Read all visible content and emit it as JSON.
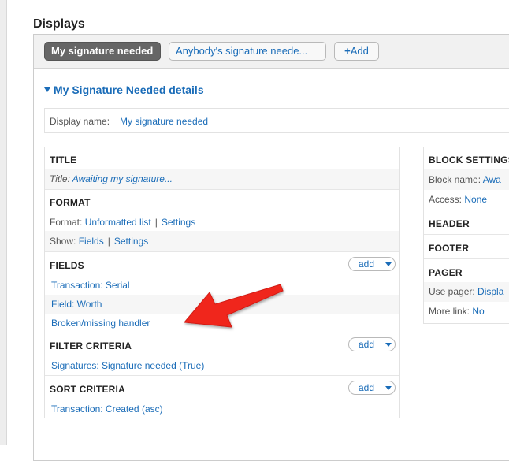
{
  "page": {
    "heading": "Displays"
  },
  "tabs": {
    "active": "My signature needed",
    "inactive": "Anybody's signature neede...",
    "add": "Add"
  },
  "details": {
    "title": "My Signature Needed details",
    "display_name_label": "Display name:",
    "display_name_value": "My signature needed"
  },
  "left": {
    "title": {
      "header": "TITLE",
      "label": "Title:",
      "value": "Awaiting my signature..."
    },
    "format": {
      "header": "FORMAT",
      "format_label": "Format:",
      "format_value": "Unformatted list",
      "format_settings": "Settings",
      "show_label": "Show:",
      "show_value": "Fields",
      "show_settings": "Settings"
    },
    "fields": {
      "header": "FIELDS",
      "add": "add",
      "items": [
        "Transaction: Serial",
        "Field: Worth",
        "Broken/missing handler"
      ]
    },
    "filter": {
      "header": "FILTER CRITERIA",
      "add": "add",
      "items": [
        "Signatures: Signature needed (True)"
      ]
    },
    "sort": {
      "header": "SORT CRITERIA",
      "add": "add",
      "items": [
        "Transaction: Created (asc)"
      ]
    }
  },
  "right": {
    "block_settings": {
      "header": "BLOCK SETTINGS",
      "name_label": "Block name:",
      "name_value": "Awa",
      "access_label": "Access:",
      "access_value": "None"
    },
    "header": "HEADER",
    "footer": "FOOTER",
    "pager": {
      "header": "PAGER",
      "use_label": "Use pager:",
      "use_value": "Displa",
      "more_label": "More link:",
      "more_value": "No"
    }
  },
  "annotation": {
    "arrow_color": "#f0281e"
  },
  "colors": {
    "link": "#1a6cb8",
    "active_tab": "#666666"
  }
}
